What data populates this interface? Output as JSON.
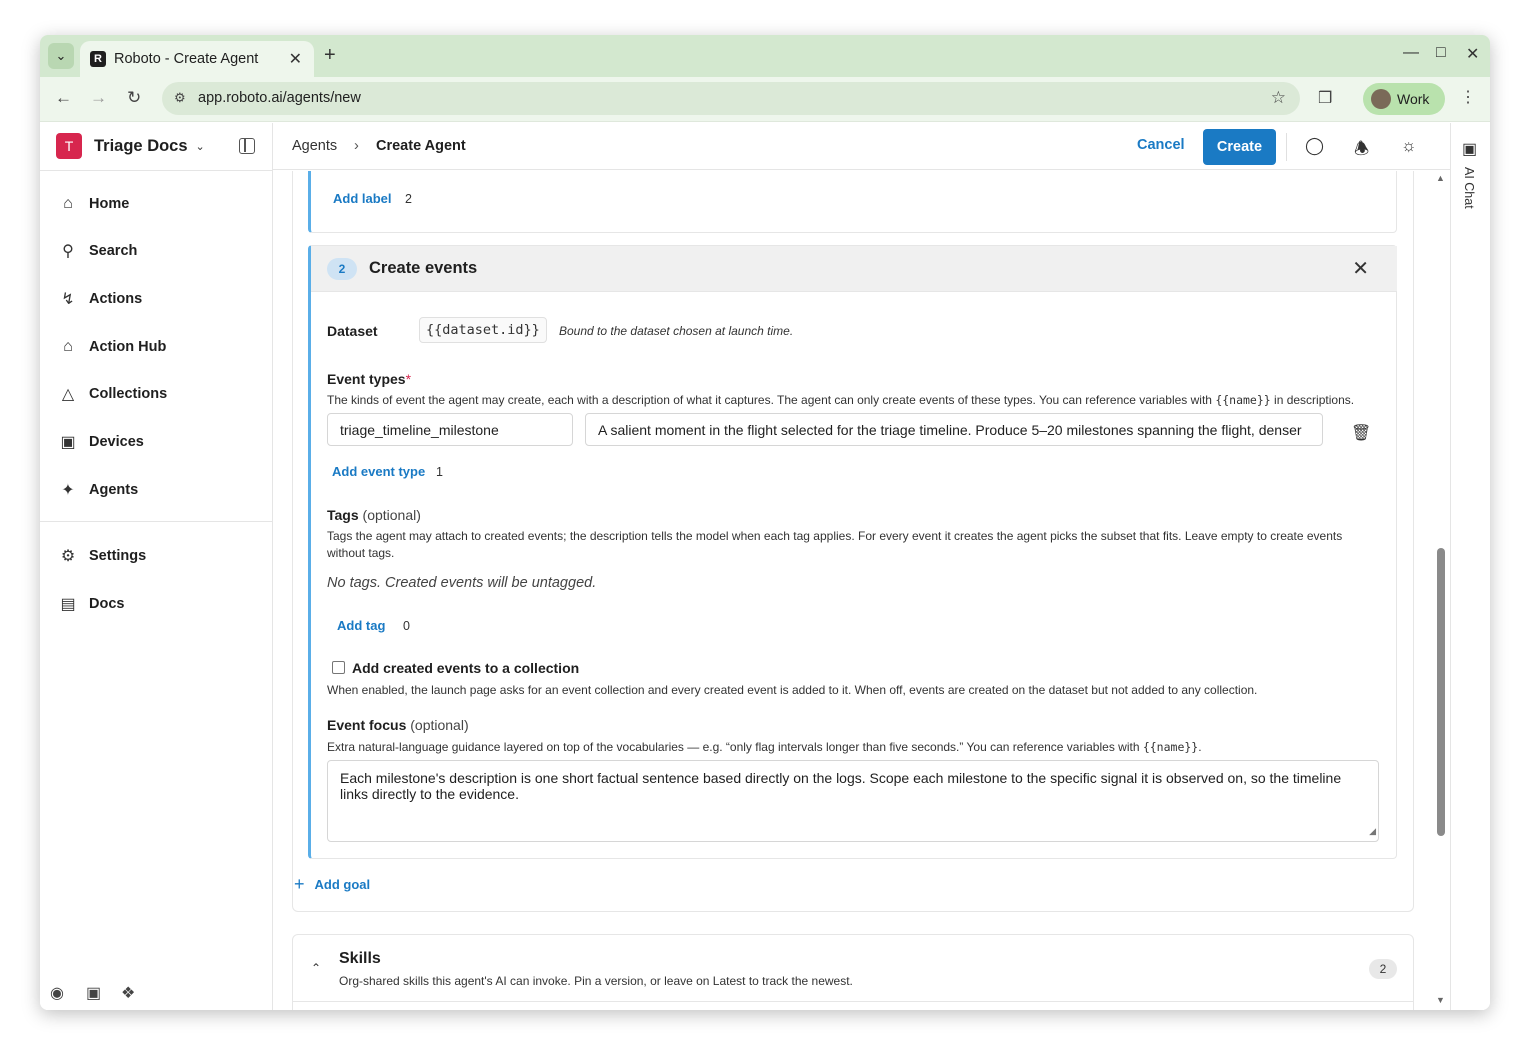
{
  "browser": {
    "tab_title": "Roboto - Create Agent",
    "tab_favicon": "R",
    "url": "app.roboto.ai/agents/new",
    "profile_label": "Work"
  },
  "sidebar": {
    "org_initial": "T",
    "org_name": "Triage Docs",
    "items": [
      {
        "label": "Home",
        "icon": "home-icon"
      },
      {
        "label": "Search",
        "icon": "search-icon"
      },
      {
        "label": "Actions",
        "icon": "lightning-icon"
      },
      {
        "label": "Action Hub",
        "icon": "store-icon"
      },
      {
        "label": "Collections",
        "icon": "shapes-icon"
      },
      {
        "label": "Devices",
        "icon": "robot-icon"
      },
      {
        "label": "Agents",
        "icon": "sparkle-icon"
      },
      {
        "label": "Settings",
        "icon": "gear-icon"
      },
      {
        "label": "Docs",
        "icon": "document-icon"
      }
    ]
  },
  "header": {
    "crumb_parent": "Agents",
    "crumb_current": "Create Agent",
    "cancel_label": "Cancel",
    "create_label": "Create"
  },
  "rail": {
    "label": "AI Chat"
  },
  "goal1": {
    "add_label": "Add label",
    "label_count": "2"
  },
  "goal2": {
    "step": "2",
    "title": "Create events",
    "dataset_label": "Dataset",
    "dataset_value": "{{dataset.id}}",
    "dataset_note": "Bound to the dataset chosen at launch time.",
    "event_types_label": "Event types",
    "required_mark": "*",
    "event_types_help_pre": "The kinds of event the agent may create, each with a description of what it captures. The agent can only create events of these types. You can reference variables with ",
    "event_types_help_code": "{{name}}",
    "event_types_help_post": " in descriptions.",
    "event_type_name": "triage_timeline_milestone",
    "event_type_desc": "A salient moment in the flight selected for the triage timeline. Produce 5–20 milestones spanning the flight, denser",
    "add_event_type": "Add event type",
    "event_type_count": "1",
    "tags_label": "Tags",
    "optional": "(optional)",
    "tags_help": "Tags the agent may attach to created events; the description tells the model when each tag applies. For every event it creates the agent picks the subset that fits. Leave empty to create events without tags.",
    "tags_empty": "No tags. Created events will be untagged.",
    "add_tag": "Add tag",
    "tag_count": "0",
    "collection_label": "Add created events to a collection",
    "collection_checked": false,
    "collection_help": "When enabled, the launch page asks for an event collection and every created event is added to it. When off, events are created on the dataset but not added to any collection.",
    "focus_label": "Event focus",
    "focus_help_pre": "Extra natural-language guidance layered on top of the vocabularies — e.g. “only flag intervals longer than five seconds.” You can reference variables with ",
    "focus_help_code": "{{name}}",
    "focus_help_post": ".",
    "focus_value": "Each milestone's description is one short factual sentence based directly on the logs. Scope each milestone to the specific signal it is observed on, so the timeline links directly to the evidence."
  },
  "add_goal": "Add goal",
  "skills": {
    "title": "Skills",
    "description": "Org-shared skills this agent's AI can invoke. Pin a version, or leave on Latest to track the newest.",
    "count": "2"
  }
}
